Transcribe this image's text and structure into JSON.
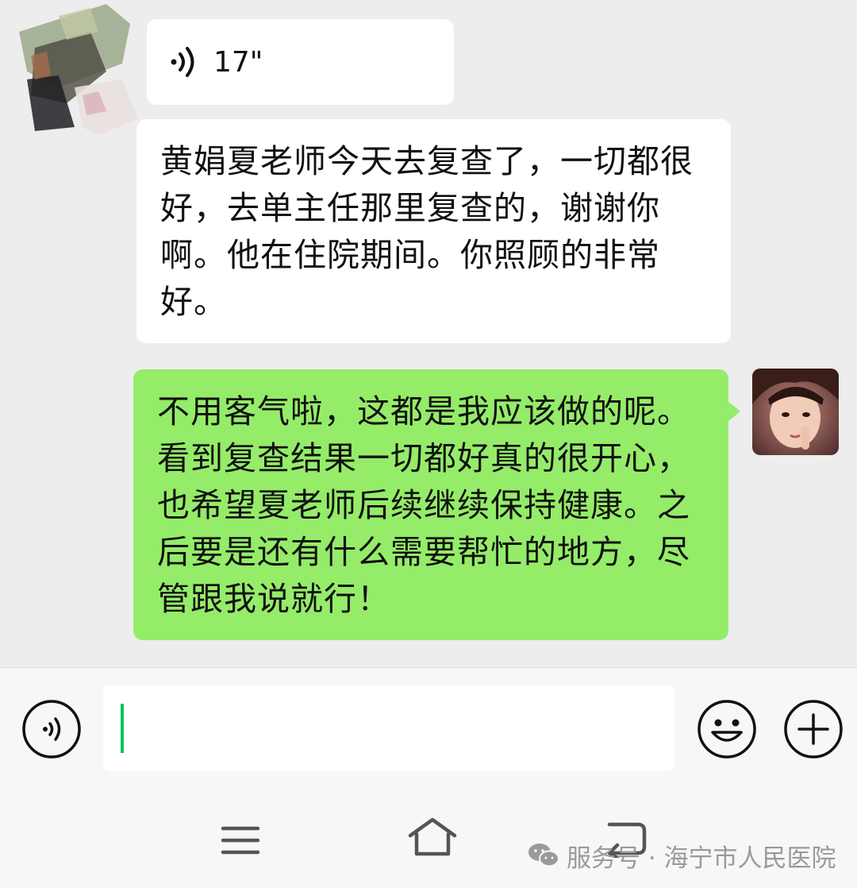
{
  "chat": {
    "voice_message": {
      "duration": "17\""
    },
    "messages": [
      {
        "side": "left",
        "text": "黄娟夏老师今天去复查了，一切都很好，去单主任那里复查的，谢谢你啊。他在住院期间。你照顾的非常好。"
      },
      {
        "side": "right",
        "text": "不用客气啦，这都是我应该做的呢。看到复查结果一切都好真的很开心，也希望夏老师后续继续保持健康。之后要是还有什么需要帮忙的地方，尽管跟我说就行！"
      }
    ]
  },
  "input": {
    "value": "",
    "placeholder": ""
  },
  "icons": {
    "voice_toggle": "voice-toggle-icon",
    "emoji": "smiley-icon",
    "plus": "plus-circle-icon",
    "nav_menu": "menu-icon",
    "nav_home": "home-icon",
    "nav_back": "back-icon"
  },
  "colors": {
    "chat_background": "#ededed",
    "sent_bubble": "#95ec69",
    "received_bubble": "#ffffff",
    "cursor": "#07c160"
  },
  "watermark": {
    "text": "服务号 · 海宁市人民医院"
  }
}
